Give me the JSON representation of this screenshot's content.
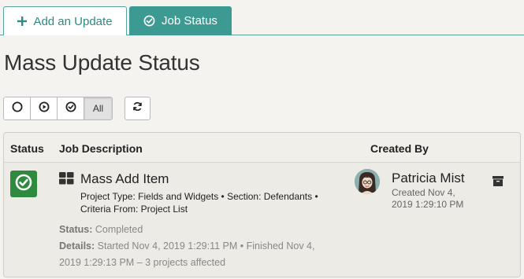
{
  "tabs": {
    "add_update": {
      "label": "Add an Update",
      "icon": "plus-icon"
    },
    "job_status": {
      "label": "Job Status",
      "icon": "check-circle-icon"
    }
  },
  "page": {
    "title": "Mass Update Status"
  },
  "filters": {
    "buttons": [
      {
        "icon": "circle-outline-icon"
      },
      {
        "icon": "play-circle-icon"
      },
      {
        "icon": "check-circle-icon"
      }
    ],
    "all_label": "All",
    "refresh_icon": "refresh-icon"
  },
  "table": {
    "headers": {
      "status": "Status",
      "job_description": "Job Description",
      "created_by": "Created By"
    },
    "rows": [
      {
        "status_icon": "check-circle-icon",
        "job_name": "Mass Add Item",
        "job_meta_line1": "Project Type: Fields and Widgets • Section: Defendants •",
        "job_meta_line2": "Criteria From: Project List",
        "status_label": "Status:",
        "status_value": "Completed",
        "details_label": "Details:",
        "details_line1": "Started Nov 4, 2019 1:29:11 PM  •  Finished Nov 4,",
        "details_line2": "2019 1:29:13 PM – 3 projects affected",
        "creator": "Patricia Mist",
        "created_line1": "Created Nov 4,",
        "created_line2": "2019 1:29:10 PM"
      }
    ]
  },
  "colors": {
    "accent": "#3c9a93",
    "status_complete": "#2e8a3e",
    "background": "#f4f3ef"
  }
}
